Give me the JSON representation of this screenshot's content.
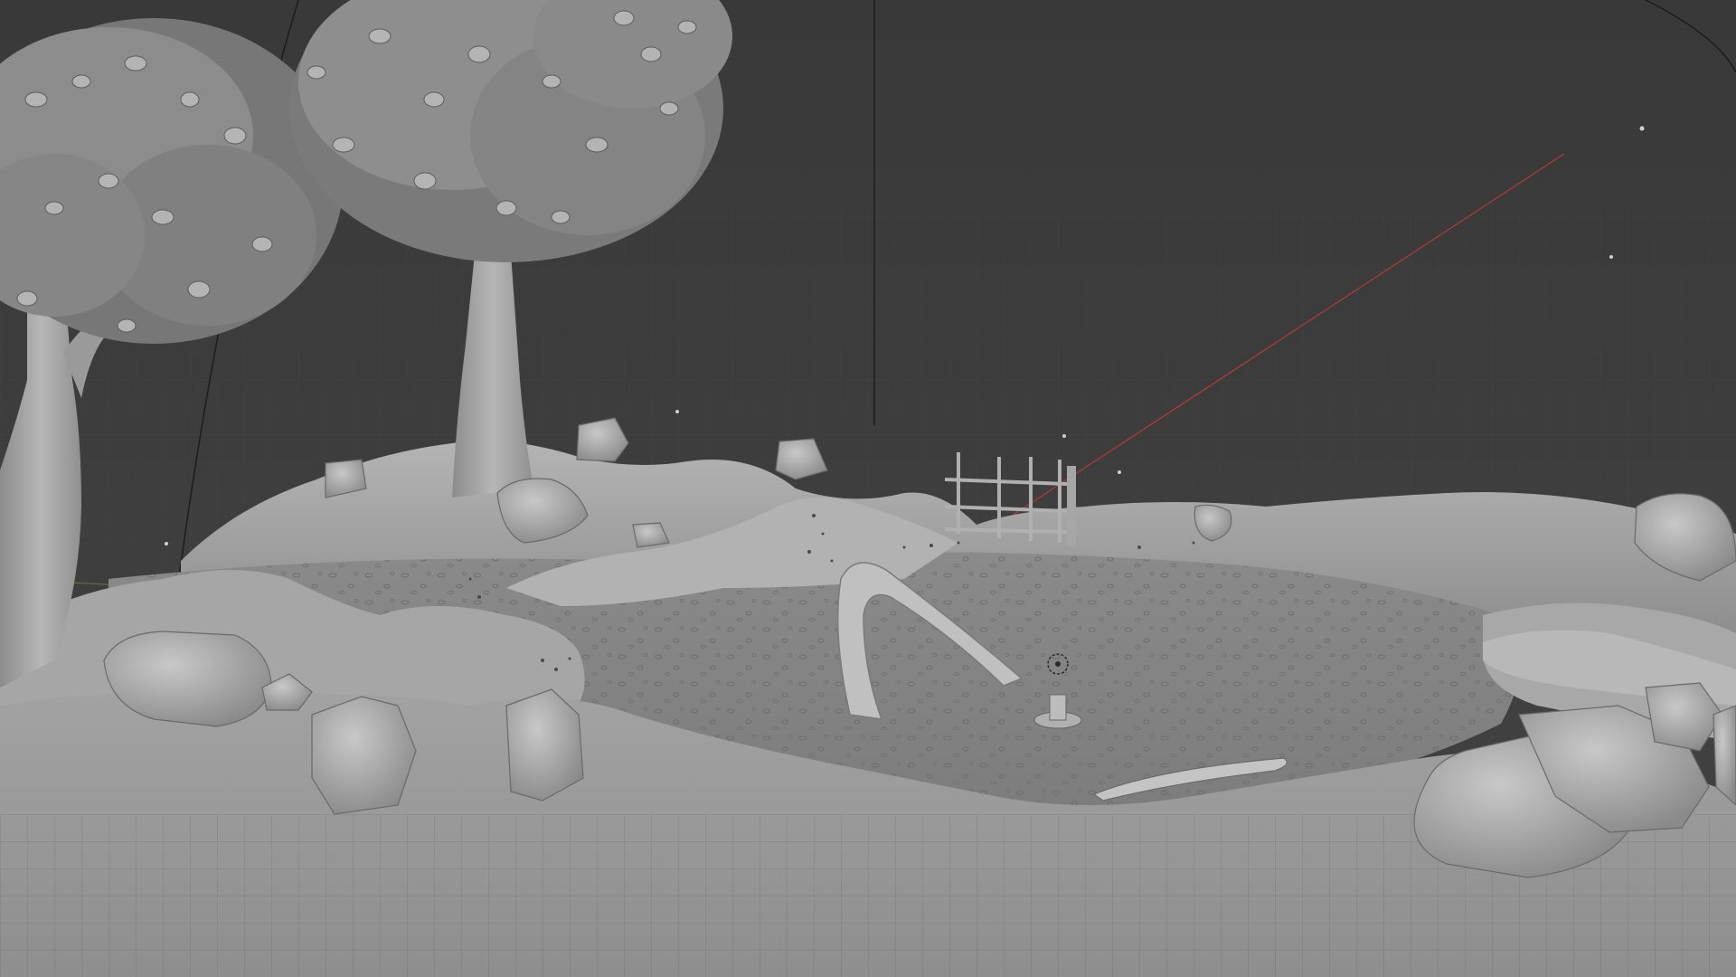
{
  "viewport": {
    "background_color": "#3d3d3d",
    "grid_color": "#4a4a4a",
    "x_axis_color": "#b33a3a",
    "y_axis_color": "#7c9a3a",
    "mesh_color": "#9c9c9c",
    "mesh_shadow_color": "#6c6c6c",
    "mesh_highlight_color": "#c8c8c8",
    "foliage_color": "#8a8a8a"
  },
  "scene": {
    "objects": [
      "tree-left",
      "tree-center",
      "terrain",
      "ground-plane",
      "rocks",
      "fence",
      "arch",
      "light-object",
      "camera-object"
    ]
  }
}
